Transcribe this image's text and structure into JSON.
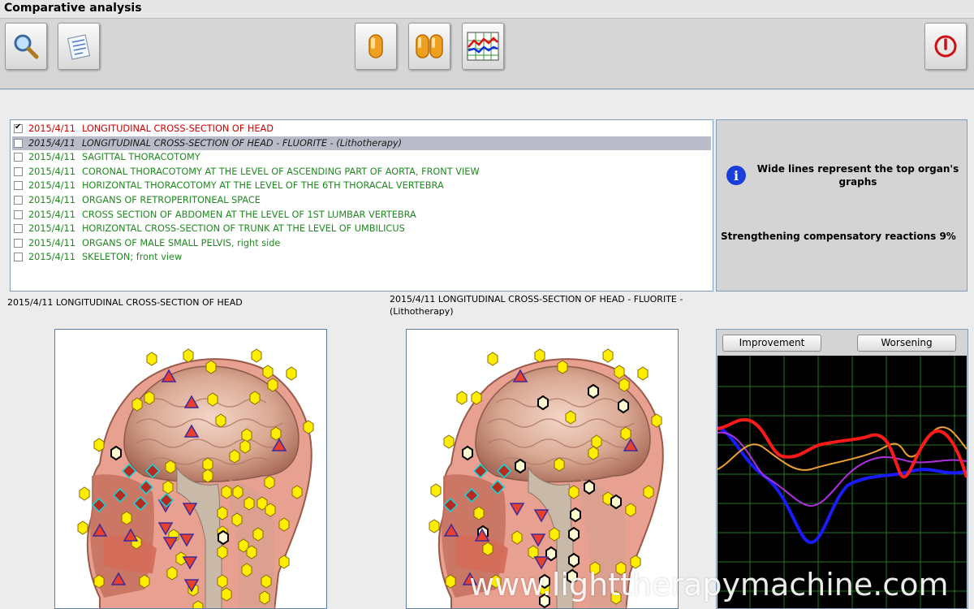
{
  "window": {
    "title": "Comparative analysis"
  },
  "toolbar": {
    "buttons": [
      {
        "name": "search-button",
        "icon": "magnifier-icon"
      },
      {
        "name": "report-button",
        "icon": "notes-icon"
      },
      {
        "name": "single-view-button",
        "icon": "single-capsule-icon"
      },
      {
        "name": "dual-view-button",
        "icon": "double-capsule-icon"
      },
      {
        "name": "graph-view-button",
        "icon": "graph-icon"
      },
      {
        "name": "power-button",
        "icon": "power-icon"
      }
    ]
  },
  "sessions": [
    {
      "date": "2015/4/11",
      "label": "LONGITUDINAL CROSS-SECTION OF HEAD",
      "checked": true,
      "selected": false,
      "color": "#d40000",
      "italic": false
    },
    {
      "date": "2015/4/11",
      "label": "LONGITUDINAL CROSS-SECTION OF HEAD - FLUORITE - (Lithotherapy)",
      "checked": false,
      "selected": true,
      "color": "#1a1a1a",
      "italic": true
    },
    {
      "date": "2015/4/11",
      "label": "SAGITTAL THORACOTOMY",
      "checked": false,
      "selected": false,
      "color": "#1f8a1f",
      "italic": false
    },
    {
      "date": "2015/4/11",
      "label": "CORONAL THORACOTOMY AT THE LEVEL OF ASCENDING PART OF AORTA, FRONT VIEW",
      "checked": false,
      "selected": false,
      "color": "#1f8a1f",
      "italic": false
    },
    {
      "date": "2015/4/11",
      "label": "HORIZONTAL THORACOTOMY AT THE LEVEL OF THE 6TH THORACAL VERTEBRA",
      "checked": false,
      "selected": false,
      "color": "#1f8a1f",
      "italic": false
    },
    {
      "date": "2015/4/11",
      "label": "ORGANS OF RETROPERITONEAL SPACE",
      "checked": false,
      "selected": false,
      "color": "#1f8a1f",
      "italic": false
    },
    {
      "date": "2015/4/11",
      "label": "CROSS SECTION OF ABDOMEN AT THE LEVEL OF 1ST LUMBAR VERTEBRA",
      "checked": false,
      "selected": false,
      "color": "#1f8a1f",
      "italic": false
    },
    {
      "date": "2015/4/11",
      "label": "HORIZONTAL CROSS-SECTION OF TRUNK AT THE LEVEL OF UMBILICUS",
      "checked": false,
      "selected": false,
      "color": "#1f8a1f",
      "italic": false
    },
    {
      "date": "2015/4/11",
      "label": "ORGANS OF MALE SMALL PELVIS, right side",
      "checked": false,
      "selected": false,
      "color": "#1f8a1f",
      "italic": false
    },
    {
      "date": "2015/4/11",
      "label": "SKELETON; front view",
      "checked": false,
      "selected": false,
      "color": "#1f8a1f",
      "italic": false
    }
  ],
  "info": {
    "icon": "info-icon",
    "message": "Wide lines represent the top organ's graphs",
    "status": "Strengthening compensatory reactions 9%"
  },
  "captions": {
    "left": "2015/4/11  LONGITUDINAL CROSS-SECTION OF HEAD",
    "right": "2015/4/11  LONGITUDINAL CROSS-SECTION OF HEAD - FLUORITE - (Lithotherapy)"
  },
  "graph": {
    "improvement_label": "Improvement",
    "worsening_label": "Worsening",
    "colors": {
      "background": "#000000",
      "grid": "#1f7a1f",
      "red": "#ff1a1a",
      "blue": "#1a1aff",
      "orange": "#f0a030",
      "purple": "#b030e0"
    }
  },
  "watermark": "www.lighttherapymachine.com"
}
